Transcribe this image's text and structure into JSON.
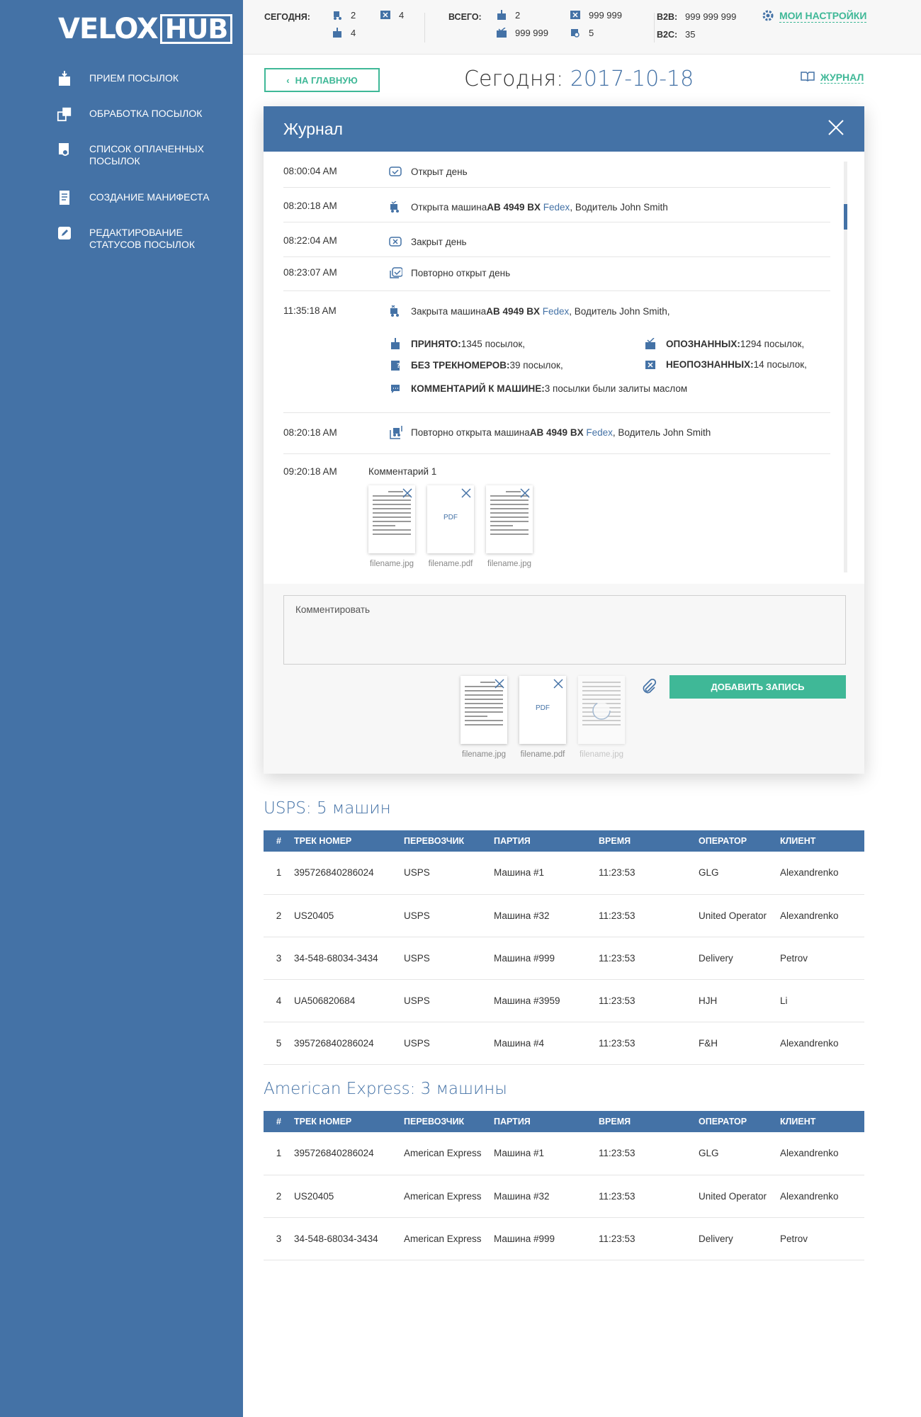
{
  "app": {
    "logo_left": "VELOX",
    "logo_right": "HUB"
  },
  "sidebar": {
    "items": [
      {
        "label": "ПРИЕМ ПОСЫЛОК",
        "icon": "box-in-icon"
      },
      {
        "label": "ОБРАБОТКА ПОСЫЛОК",
        "icon": "boxes-cycle-icon"
      },
      {
        "label": "СПИСОК ОПЛАЧЕННЫХ ПОСЫЛОК",
        "icon": "box-coin-icon"
      },
      {
        "label": "СОЗДАНИЕ МАНИФЕСТА",
        "icon": "manifest-icon"
      },
      {
        "label": "РЕДАКТИРОВАНИЕ СТАТУСОВ ПОСЫЛОК",
        "icon": "edit-status-icon"
      }
    ]
  },
  "topbar": {
    "today_label": "СЕГОДНЯ:",
    "today_trucks": "2",
    "today_unknown": "4",
    "today_accepted": "4",
    "total_label": "ВСЕГО:",
    "total_accepted": "2",
    "total_identified": "999 999",
    "total_unknown": "999 999",
    "total_paid": "5",
    "b2b_label": "B2B:",
    "b2b_value": "999 999 999",
    "b2c_label": "B2C:",
    "b2c_value": "35",
    "settings_label": "МОИ НАСТРОЙКИ"
  },
  "page": {
    "back_label": "НА ГЛАВНУЮ",
    "today_prefix": "Сегодня:",
    "today_date": "2017-10-18",
    "journal_link": "ЖУРНАЛ"
  },
  "journal": {
    "title": "Журнал",
    "entries": [
      {
        "time": "08:00:04 AM",
        "text": "Открыт день"
      },
      {
        "time": "08:20:18 AM",
        "text_pre": "Открыта машина ",
        "plate": "AB 4949 BX",
        "carrier": "Fedex",
        "text_post": ", Водитель John Smith"
      },
      {
        "time": "08:22:04 AM",
        "text": "Закрыт день"
      },
      {
        "time": "08:23:07 AM",
        "text": "Повторно открыт день"
      },
      {
        "time": "11:35:18 AM",
        "text_pre": "Закрыта машина ",
        "plate": "AB 4949 BX",
        "carrier": "Fedex",
        "text_post": ", Водитель John Smith,"
      },
      {
        "time": "08:20:18 AM",
        "text_pre": "Повторно открыта машина ",
        "plate": "AB 4949 BX",
        "carrier": "Fedex",
        "text_post": ", Водитель John Smith"
      },
      {
        "time": "09:20:18 AM",
        "text": "Комментарий 1"
      }
    ],
    "stats": {
      "accepted_label": "ПРИНЯТО:",
      "accepted_value": " 1345 посылок,",
      "identified_label": "ОПОЗНАННЫХ:",
      "identified_value": " 1294 посылок,",
      "no_track_label": "БЕЗ ТРЕКНОМЕРОВ:",
      "no_track_value": " 39 посылок,",
      "unidentified_label": "НЕОПОЗНАННЫХ:",
      "unidentified_value": " 14 посылок,",
      "comment_label": "КОММЕНТАРИЙ К МАШИНЕ:",
      "comment_value": " 3 посылки были залиты маслом"
    },
    "attachments": [
      "filename.jpg",
      "filename.pdf",
      "filename.jpg"
    ],
    "pdf_mark": "PDF",
    "composer_placeholder": "Комментировать",
    "composer_attachments": [
      "filename.jpg",
      "filename.pdf",
      "filename.jpg"
    ],
    "add_button": "ДОБАВИТЬ ЗАПИСЬ"
  },
  "tables": {
    "headers": [
      "#",
      "ТРЕК НОМЕР",
      "ПЕРЕВОЗЧИК",
      "ПАРТИЯ",
      "ВРЕМЯ",
      "ОПЕРАТОР",
      "КЛИЕНТ"
    ],
    "usps_title": "USPS: 5 машин",
    "usps_rows": [
      [
        "1",
        "395726840286024",
        "USPS",
        "Машина #1",
        "11:23:53",
        "GLG",
        "Alexandrenko"
      ],
      [
        "2",
        "US20405",
        "USPS",
        "Машина #32",
        "11:23:53",
        "United Operator",
        "Alexandrenko"
      ],
      [
        "3",
        "34-548-68034-3434",
        "USPS",
        "Машина #999",
        "11:23:53",
        "Delivery",
        "Petrov"
      ],
      [
        "4",
        "UA506820684",
        "USPS",
        "Машина #3959",
        "11:23:53",
        "HJH",
        "Li"
      ],
      [
        "5",
        "395726840286024",
        "USPS",
        "Машина #4",
        "11:23:53",
        "F&H",
        "Alexandrenko"
      ]
    ],
    "amex_title": "American Express: 3 машины",
    "amex_rows": [
      [
        "1",
        "395726840286024",
        "American Express",
        "Машина #1",
        "11:23:53",
        "GLG",
        "Alexandrenko"
      ],
      [
        "2",
        "US20405",
        "American Express",
        "Машина #32",
        "11:23:53",
        "United Operator",
        "Alexandrenko"
      ],
      [
        "3",
        "34-548-68034-3434",
        "American Express",
        "Машина #999",
        "11:23:53",
        "Delivery",
        "Petrov"
      ]
    ]
  },
  "colors": {
    "primary": "#4472a6",
    "accent": "#3fb897"
  }
}
